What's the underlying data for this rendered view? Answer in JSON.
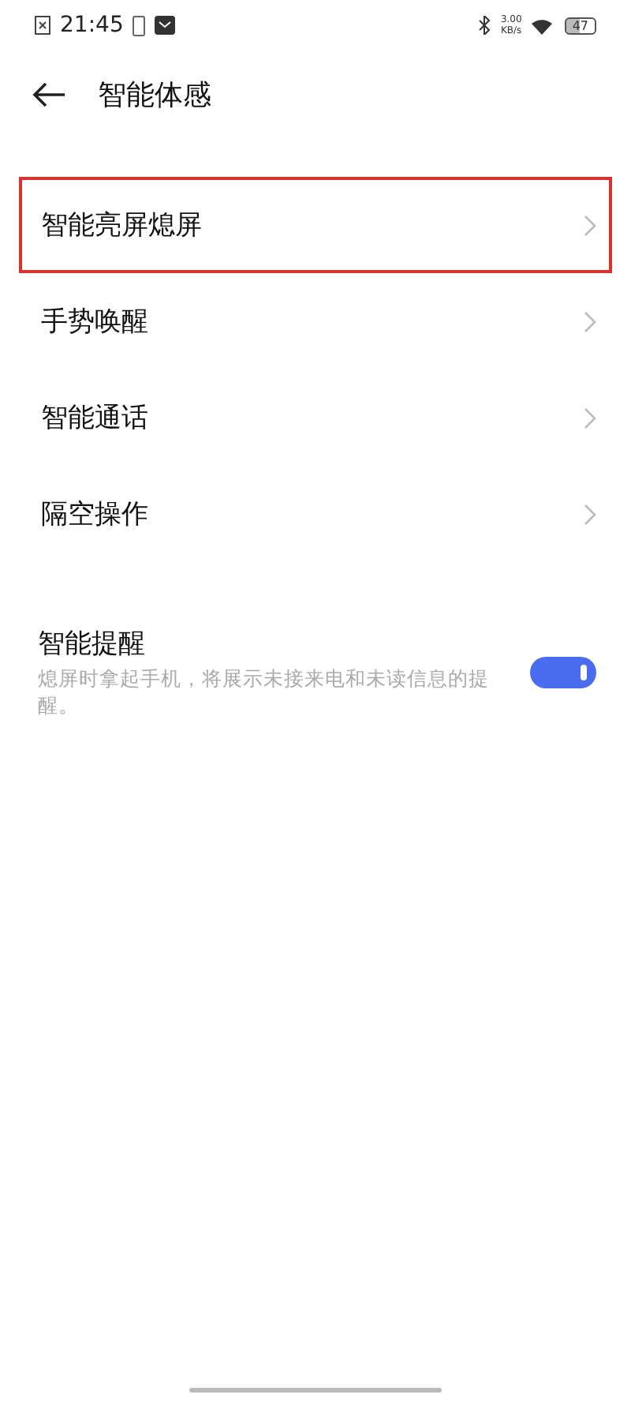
{
  "status_bar": {
    "time": "21:45",
    "speed": "3.00",
    "speed_unit": "KB/s",
    "battery": "47"
  },
  "header": {
    "title": "智能体感"
  },
  "menu_items": [
    {
      "label": "智能亮屏熄屏",
      "highlighted": true
    },
    {
      "label": "手势唤醒",
      "highlighted": false
    },
    {
      "label": "智能通话",
      "highlighted": false
    },
    {
      "label": "隔空操作",
      "highlighted": false
    }
  ],
  "setting": {
    "title": "智能提醒",
    "description": "熄屏时拿起手机，将展示未接来电和未读信息的提醒。",
    "on": true
  }
}
